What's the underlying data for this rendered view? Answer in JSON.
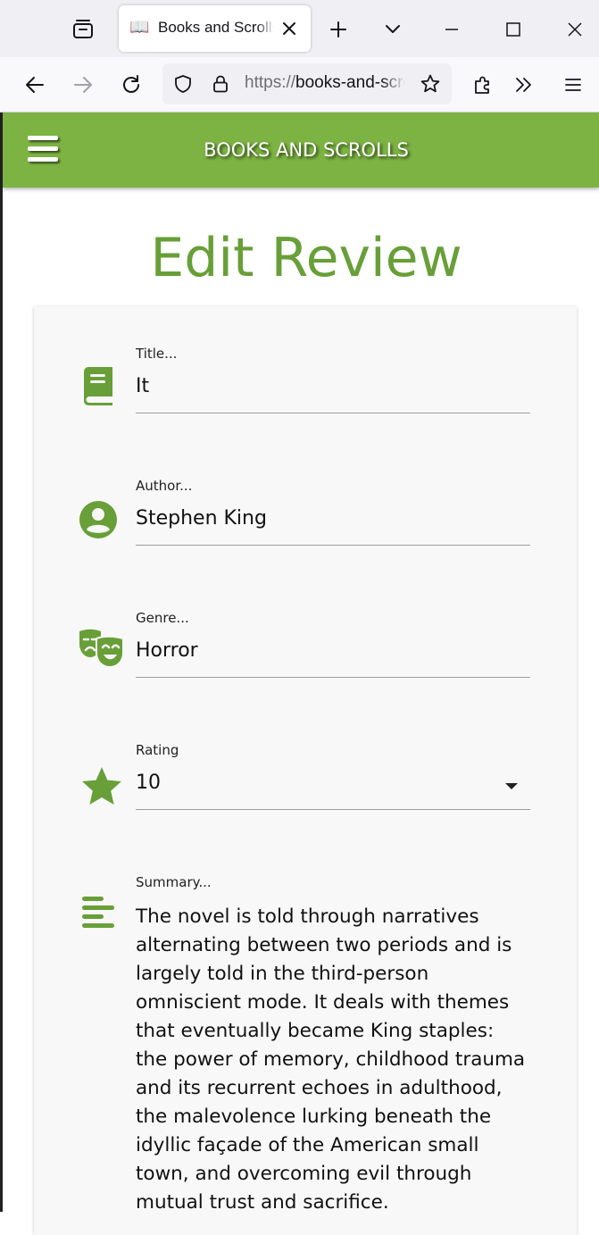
{
  "browser": {
    "tab_title": "Books and Scrolls",
    "tab_favicon": "📖",
    "url_protocol": "https://",
    "url_host": "books-and-scrolls"
  },
  "app": {
    "brand": "BOOKS AND SCROLLS",
    "heading": "Edit Review",
    "accent_color": "#7cb342",
    "icon_color": "#689f38"
  },
  "form": {
    "title": {
      "label": "Title...",
      "value": "It",
      "icon": "book-icon"
    },
    "author": {
      "label": "Author...",
      "value": "Stephen King",
      "icon": "account-circle-icon"
    },
    "genre": {
      "label": "Genre...",
      "value": "Horror",
      "icon": "theater-masks-icon"
    },
    "rating": {
      "label": "Rating",
      "value": "10",
      "icon": "star-icon"
    },
    "summary": {
      "label": "Summary...",
      "value": "The novel is told through narratives alternating between two periods and is largely told in the third-person omniscient mode. It deals with themes that eventually became King staples: the power of memory, childhood trauma and its recurrent echoes in adulthood, the malevolence lurking beneath the idyllic façade of the American small town, and overcoming evil through mutual trust and sacrifice.",
      "icon": "align-left-icon"
    }
  }
}
